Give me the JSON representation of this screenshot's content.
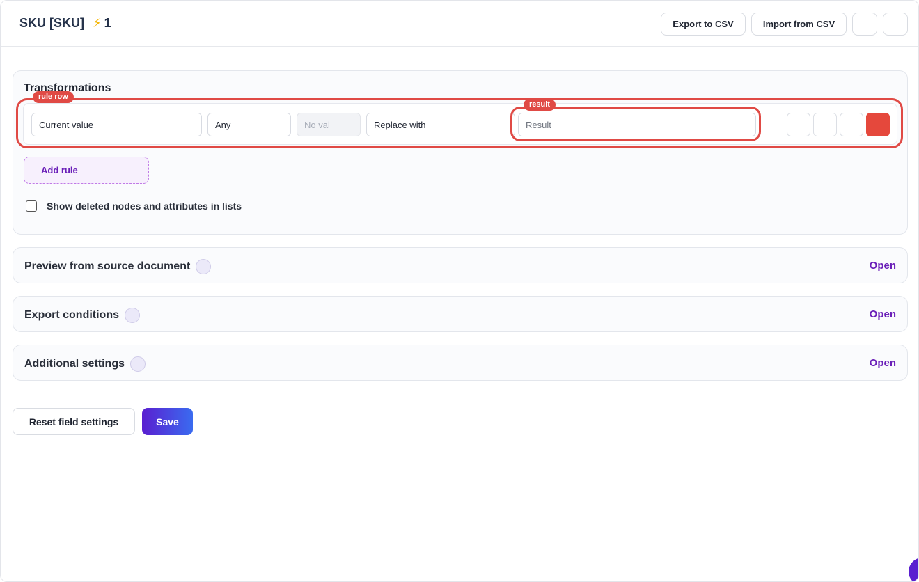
{
  "header": {
    "title": "SKU [SKU]",
    "bolt_icon": "⚡",
    "count": "1",
    "export_label": "Export to CSV",
    "import_label": "Import from CSV"
  },
  "transformations": {
    "title": "Transformations",
    "rule_row_tag": "rule row",
    "result_tag": "result",
    "fields": {
      "current_value": "Current value",
      "condition": "Any",
      "value_placeholder": "No val",
      "action": "Replace with",
      "result_placeholder": "Result"
    },
    "add_rule_label": "Add rule",
    "show_deleted_label": "Show deleted nodes and attributes in lists",
    "show_deleted_checked": false
  },
  "sections": [
    {
      "title": "Preview from source document",
      "action": "Open"
    },
    {
      "title": "Export conditions",
      "action": "Open"
    },
    {
      "title": "Additional settings",
      "action": "Open"
    }
  ],
  "footer": {
    "reset_label": "Reset field settings",
    "save_label": "Save"
  },
  "colors": {
    "accent": "#6a1fb8",
    "danger": "#e5483c",
    "annotation": "#e04a45"
  }
}
